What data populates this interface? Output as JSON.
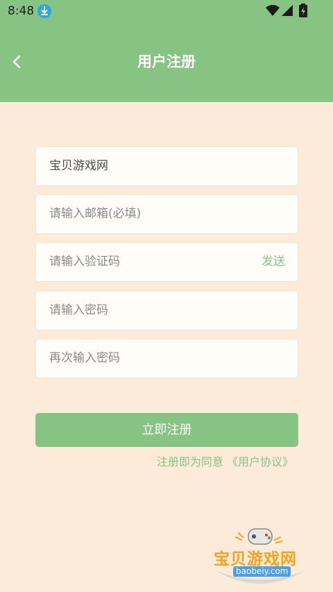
{
  "status_bar": {
    "time": "8:48",
    "icons": [
      "download-icon",
      "wifi-icon",
      "signal-icon",
      "battery-charging-icon"
    ]
  },
  "header": {
    "title": "用户注册",
    "back_icon": "chevron-left-icon",
    "color": "#87c382"
  },
  "form": {
    "site_name": {
      "value": "宝贝游戏网"
    },
    "email": {
      "placeholder": "请输入邮箱(必填)"
    },
    "code": {
      "placeholder": "请输入验证码",
      "send_label": "发送"
    },
    "password": {
      "placeholder": "请输入密码"
    },
    "password_confirm": {
      "placeholder": "再次输入密码"
    }
  },
  "submit_label": "立即注册",
  "agreement": "注册即为同意 《用户协议》",
  "watermark": {
    "text": "宝贝游戏网",
    "url": "baobeiy.com"
  },
  "colors": {
    "accent": "#87c382",
    "background": "#fcebd8",
    "field": "#fffdf8"
  }
}
